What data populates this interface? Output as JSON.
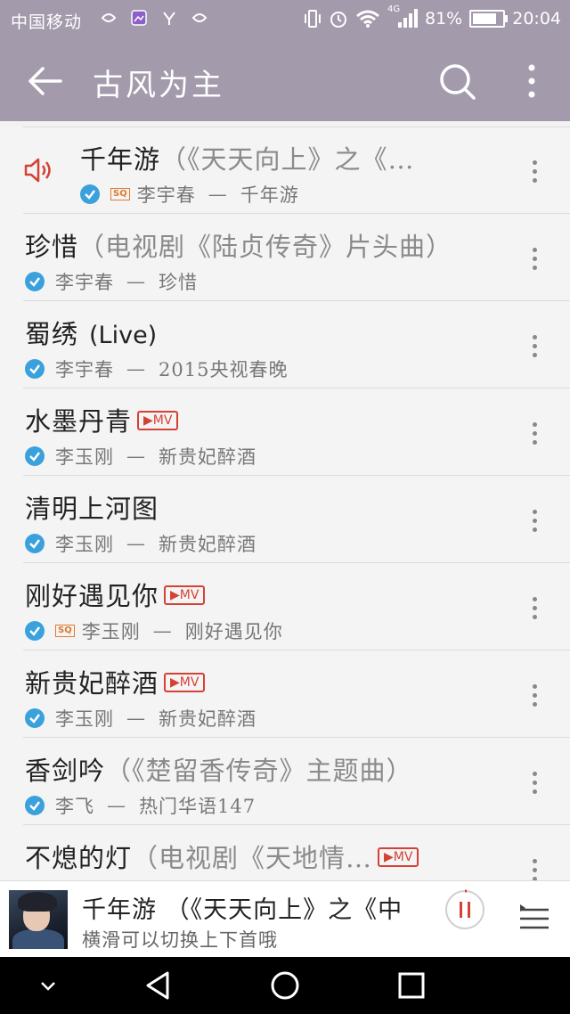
{
  "status_bar": {
    "carrier": "中国移动",
    "network": "4G",
    "battery_text": "81%",
    "battery_level": 0.81,
    "time": "20:04"
  },
  "app_bar": {
    "title": "古风为主",
    "back_icon": "arrow-left-icon",
    "search_icon": "search-icon",
    "more_icon": "more-vertical-icon"
  },
  "songs": [
    {
      "title": "千年游",
      "subtitle": "（《天天向上》之《…",
      "mv": false,
      "sq": true,
      "artist": "李宇春",
      "sep": "—",
      "album": "千年游",
      "playing": true
    },
    {
      "title": "珍惜",
      "subtitle": "（电视剧《陆贞传奇》片头曲）",
      "mv": false,
      "sq": false,
      "artist": "李宇春",
      "sep": "—",
      "album": "珍惜",
      "playing": false
    },
    {
      "title": "蜀绣",
      "subtitle": "(Live)",
      "mv": false,
      "sq": false,
      "artist": "李宇春",
      "sep": "—",
      "album": "2015央视春晚",
      "playing": false
    },
    {
      "title": "水墨丹青",
      "subtitle": "",
      "mv": true,
      "sq": false,
      "artist": "李玉刚",
      "sep": "—",
      "album": "新贵妃醉酒",
      "playing": false
    },
    {
      "title": "清明上河图",
      "subtitle": "",
      "mv": false,
      "sq": false,
      "artist": "李玉刚",
      "sep": "—",
      "album": "新贵妃醉酒",
      "playing": false
    },
    {
      "title": "刚好遇见你",
      "subtitle": "",
      "mv": true,
      "sq": true,
      "artist": "李玉刚",
      "sep": "—",
      "album": "刚好遇见你",
      "playing": false
    },
    {
      "title": "新贵妃醉酒",
      "subtitle": "",
      "mv": true,
      "sq": false,
      "artist": "李玉刚",
      "sep": "—",
      "album": "新贵妃醉酒",
      "playing": false
    },
    {
      "title": "香剑吟",
      "subtitle": "（《楚留香传奇》主题曲）",
      "mv": false,
      "sq": false,
      "artist": "李飞",
      "sep": "—",
      "album": "热门华语147",
      "playing": false
    },
    {
      "title": "不熄的灯",
      "subtitle": "（电视剧《天地情…",
      "mv": true,
      "sq": false,
      "artist": "",
      "sep": "",
      "album": "",
      "playing": false
    }
  ],
  "badges": {
    "mv_label": "▶MV",
    "sq_label": "SQ"
  },
  "now_playing": {
    "title": "千年游 （《天天向上》之《中",
    "hint": "横滑可以切换上下首哦"
  },
  "colors": {
    "header": "#a39aac",
    "accent_red": "#d44236",
    "check_blue": "#3aa1dc",
    "sq_orange": "#e07a2e"
  }
}
